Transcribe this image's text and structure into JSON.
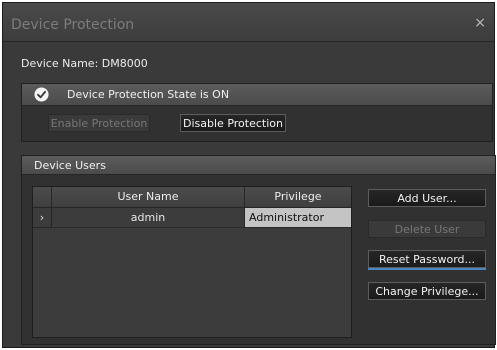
{
  "window": {
    "title": "Device Protection",
    "close_glyph": "×"
  },
  "device": {
    "label": "Device Name: DM8000"
  },
  "protection": {
    "state_text": "Device Protection State is ON",
    "state_icon": "check-circle-icon",
    "enable_label": "Enable Protection",
    "disable_label": "Disable Protection"
  },
  "users": {
    "group_title": "Device Users",
    "columns": [
      "User Name",
      "Privilege"
    ],
    "rows": [
      {
        "user_name": "admin",
        "privilege": "Administrator"
      }
    ],
    "row_indicator": "›",
    "add_label": "Add User...",
    "delete_label": "Delete User",
    "reset_label": "Reset Password...",
    "change_label": "Change Privilege..."
  },
  "colors": {
    "background": "#3a3a3a",
    "focus_accent": "#4a86c0",
    "selected_cell": "#c4c4c4"
  }
}
